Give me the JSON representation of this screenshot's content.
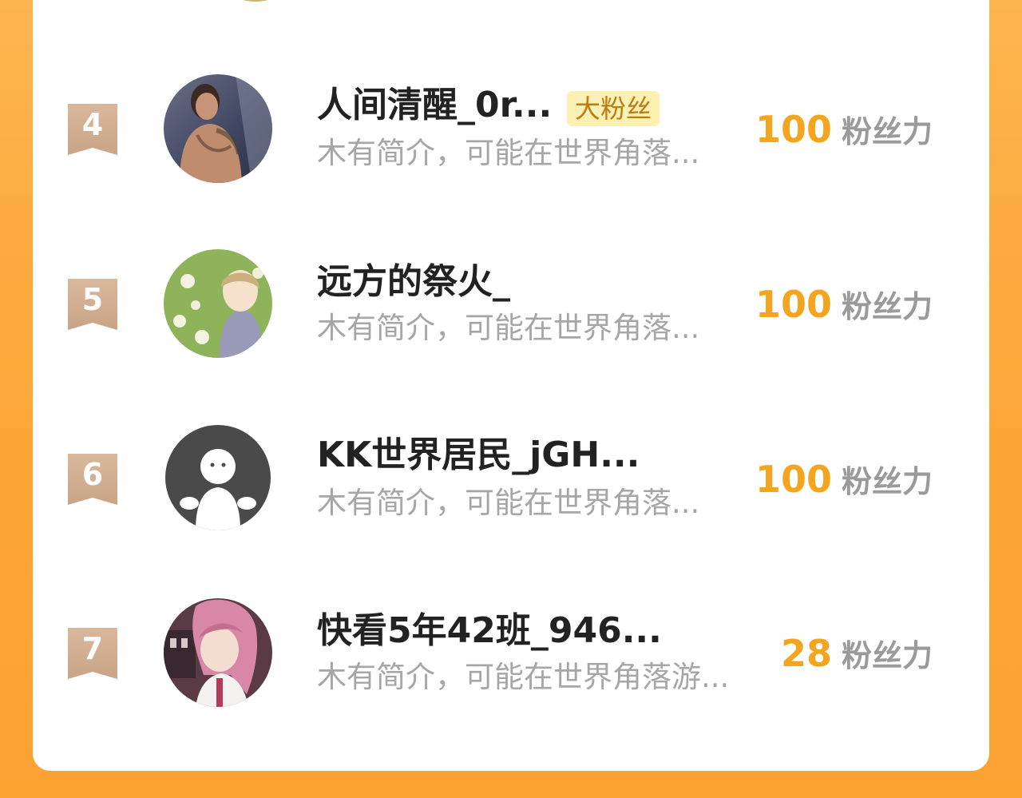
{
  "ranking": {
    "rows": [
      {
        "rank": "4",
        "name": "人间清醒_0r...",
        "badge": "大粉丝",
        "intro": "木有简介，可能在世界角落...",
        "score": "100",
        "unit": "粉丝力"
      },
      {
        "rank": "5",
        "name": "远方的祭火_",
        "badge": "",
        "intro": "木有简介，可能在世界角落...",
        "score": "100",
        "unit": "粉丝力"
      },
      {
        "rank": "6",
        "name": "KK世界居民_jGH...",
        "badge": "",
        "intro": "木有简介，可能在世界角落...",
        "score": "100",
        "unit": "粉丝力"
      },
      {
        "rank": "7",
        "name": "快看5年42班_946...",
        "badge": "",
        "intro": "木有简介，可能在世界角落游...",
        "score": "28",
        "unit": "粉丝力"
      }
    ]
  },
  "colors": {
    "score": "#f4a51f",
    "rank_ribbon": "#d2ae92",
    "badge_bg": "#fdf0b3",
    "page_bg": "#fca83a"
  }
}
